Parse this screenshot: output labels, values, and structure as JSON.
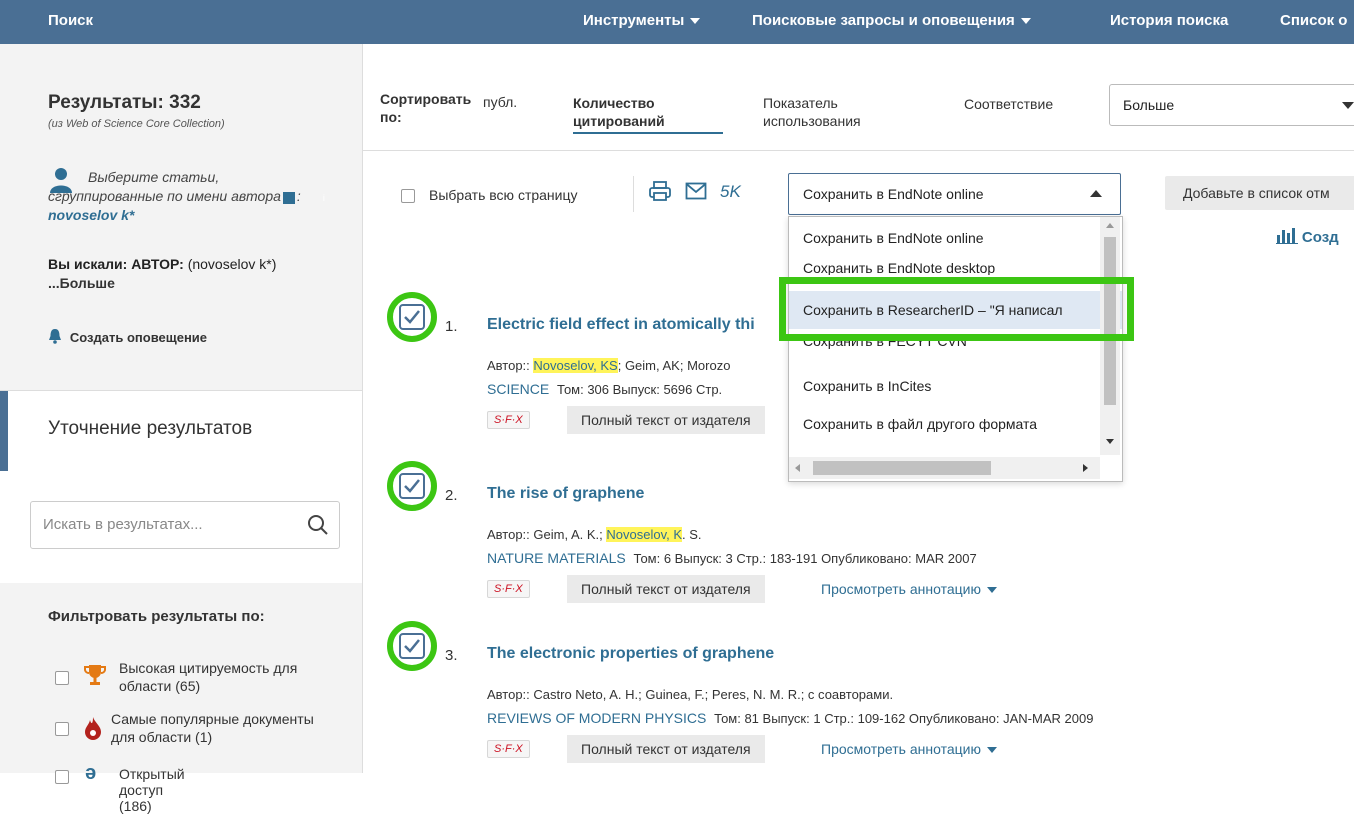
{
  "topbar": {
    "search": "Поиск",
    "tools": "Инструменты",
    "queries": "Поисковые запросы и оповещения",
    "history": "История поиска",
    "list": "Список о"
  },
  "sidebar": {
    "results_title": "Результаты: 332",
    "results_source": "(из Web of Science Core Collection)",
    "author_hint": "Выберите статьи, сгруппированные по имени автора",
    "author_name": "novoselov k*",
    "searched_label": "Вы искали: АВТОР:",
    "searched_value": "(novoselov k*)",
    "more": "...Больше",
    "create_alert": "Создать оповещение",
    "refine_title": "Уточнение результатов",
    "search_placeholder": "Искать в результатах...",
    "filter_title": "Фильтровать результаты по:",
    "filters": [
      {
        "label": "Высокая цитируемость для области (65)"
      },
      {
        "label": "Самые популярные документы для области (1)"
      },
      {
        "label": "Открытый доступ (186)"
      }
    ]
  },
  "sort": {
    "label": "Сортировать по:",
    "options": [
      "публ.",
      "Количество цитирований",
      "Показатель использования",
      "Соответствие"
    ],
    "more_select": "Больше"
  },
  "toolbar": {
    "select_all": "Выбрать всю страницу",
    "count": "5K",
    "save_select": "Сохранить в EndNote online",
    "add_to_list": "Добавьте в список отм",
    "create_report": "Созд"
  },
  "dropdown": {
    "items": [
      "Сохранить в EndNote online",
      "Сохранить в EndNote desktop",
      "Сохранить в ResearcherID – \"Я написал",
      "Сохранить в FECYT CVN",
      "Сохранить в InCites",
      "Сохранить в файл другого формата"
    ]
  },
  "results": [
    {
      "num": "1.",
      "title": "Electric field effect in atomically thi",
      "authors_prefix": "Автор::",
      "authors_hl": "Novoselov, KS",
      "authors_rest": "; Geim, AK; Morozo",
      "journal": "SCIENCE",
      "meta": "Том: 306  Выпуск: 5696  Стр.",
      "full_text": "Полный текст от издателя"
    },
    {
      "num": "2.",
      "title": "The rise of graphene",
      "authors_prefix": "Автор:: Geim, A. K.;",
      "authors_hl": "Novoselov, K",
      "authors_rest": ". S.",
      "journal": "NATURE MATERIALS",
      "meta": "Том: 6  Выпуск: 3  Стр.: 183-191  Опубликовано: MAR 2007",
      "full_text": "Полный текст от издателя",
      "abstract": "Просмотреть аннотацию"
    },
    {
      "num": "3.",
      "title": "The electronic properties of graphene",
      "authors_prefix": "Автор:: Castro Neto, A. H.; Guinea, F.; Peres, N. M. R.; с соавторами.",
      "journal": "REVIEWS OF MODERN PHYSICS",
      "meta": "Том: 81  Выпуск: 1  Стр.: 109-162  Опубликовано: JAN-MAR 2009",
      "full_text": "Полный текст от издателя",
      "abstract": "Просмотреть аннотацию"
    }
  ],
  "sfx_label": "S·F·X",
  "colors": {
    "topbar": "#4a6f94",
    "link": "#2f6e93",
    "highlight_ring": "#3cc613",
    "author_highlight": "#fff45a"
  }
}
